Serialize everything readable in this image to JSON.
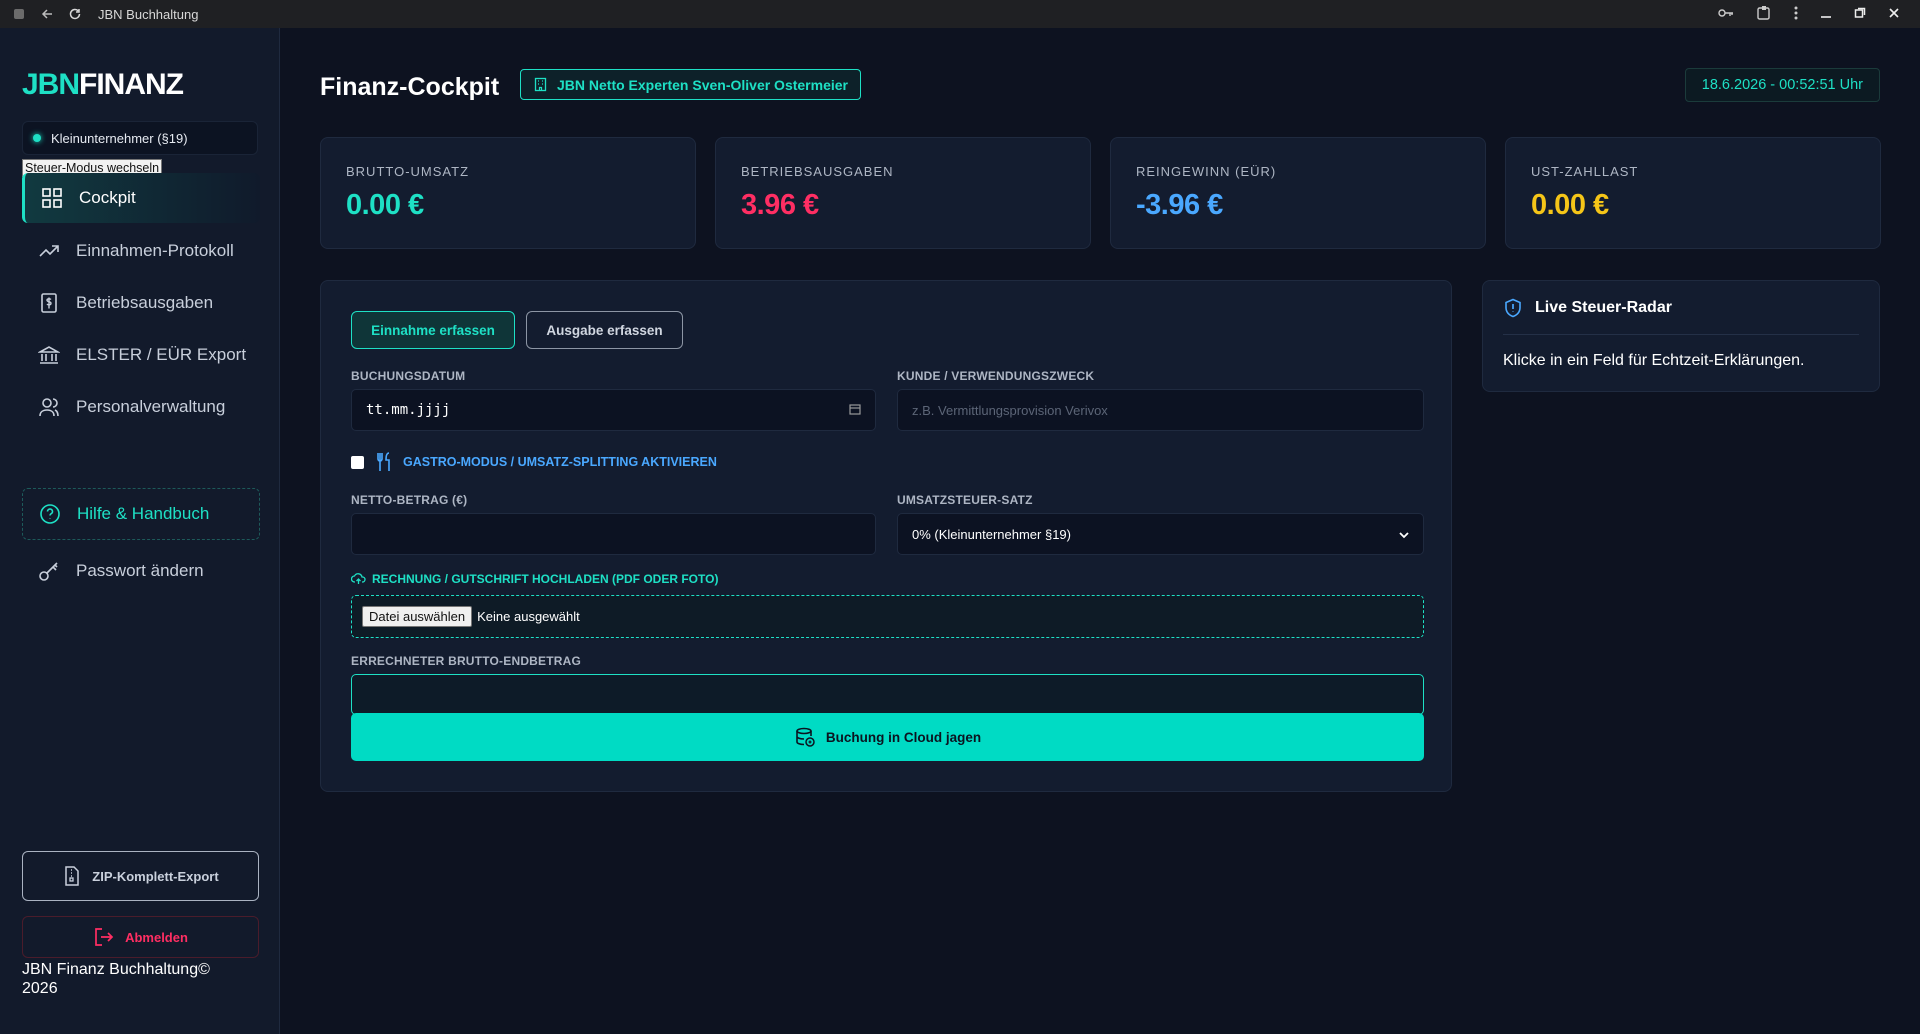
{
  "browser": {
    "title": "JBN Buchhaltung"
  },
  "sidebar": {
    "logo_part1": "JBN",
    "logo_part2": "FINANZ",
    "mode_label": "Kleinunternehmer (§19)",
    "mode_switch_label": "Steuer-Modus wechseln",
    "nav": [
      {
        "label": "Cockpit",
        "icon": "grid-icon"
      },
      {
        "label": "Einnahmen-Protokoll",
        "icon": "trend-up-icon"
      },
      {
        "label": "Betriebsausgaben",
        "icon": "receipt-icon"
      },
      {
        "label": "ELSTER / EÜR Export",
        "icon": "bank-icon"
      },
      {
        "label": "Personalverwaltung",
        "icon": "users-icon"
      },
      {
        "label": "Hilfe & Handbuch",
        "icon": "help-icon"
      },
      {
        "label": "Passwort ändern",
        "icon": "key-icon"
      }
    ],
    "zip_export_label": "ZIP-Komplett-Export",
    "logout_label": "Abmelden",
    "footer": "JBN Finanz Buchhaltung© 2026"
  },
  "header": {
    "title": "Finanz-Cockpit",
    "company": "JBN Netto Experten Sven-Oliver Ostermeier",
    "clock": "18.6.2026 - 00:52:51 Uhr"
  },
  "stats": [
    {
      "label": "BRUTTO-UMSATZ",
      "value": "0.00 €",
      "color": "#1ee0c5"
    },
    {
      "label": "BETRIEBSAUSGABEN",
      "value": "3.96 €",
      "color": "#ff2e63"
    },
    {
      "label": "REINGEWINN (EÜR)",
      "value": "-3.96 €",
      "color": "#4aa8ff"
    },
    {
      "label": "UST-ZAHLLAST",
      "value": "0.00 €",
      "color": "#f5c518"
    }
  ],
  "form": {
    "tab_income": "Einnahme erfassen",
    "tab_expense": "Ausgabe erfassen",
    "date_label": "BUCHUNGSDATUM",
    "date_value": "tt.mm.jjjj",
    "customer_label": "KUNDE / VERWENDUNGSZWECK",
    "customer_placeholder": "z.B. Vermittlungsprovision Verivox",
    "gastro_label": "GASTRO-MODUS / UMSATZ-SPLITTING AKTIVIEREN",
    "net_label": "NETTO-BETRAG (€)",
    "vat_label": "UMSATZSTEUER-SATZ",
    "vat_value": "0% (Kleinunternehmer §19)",
    "upload_label": "RECHNUNG / GUTSCHRIFT HOCHLADEN (PDF ODER FOTO)",
    "file_button": "Datei auswählen",
    "file_status": "Keine ausgewählt",
    "gross_label": "ERRECHNETER BRUTTO-ENDBETRAG",
    "submit_label": "Buchung in Cloud jagen"
  },
  "radar": {
    "title": "Live Steuer-Radar",
    "body": "Klicke in ein Feld für Echtzeit-Erklärungen."
  },
  "colors": {
    "accent": "#1ee0c5",
    "danger": "#ff2e63",
    "info": "#4aa8ff",
    "warning": "#f5c518",
    "background": "#0d1220",
    "card": "#131c2f"
  }
}
